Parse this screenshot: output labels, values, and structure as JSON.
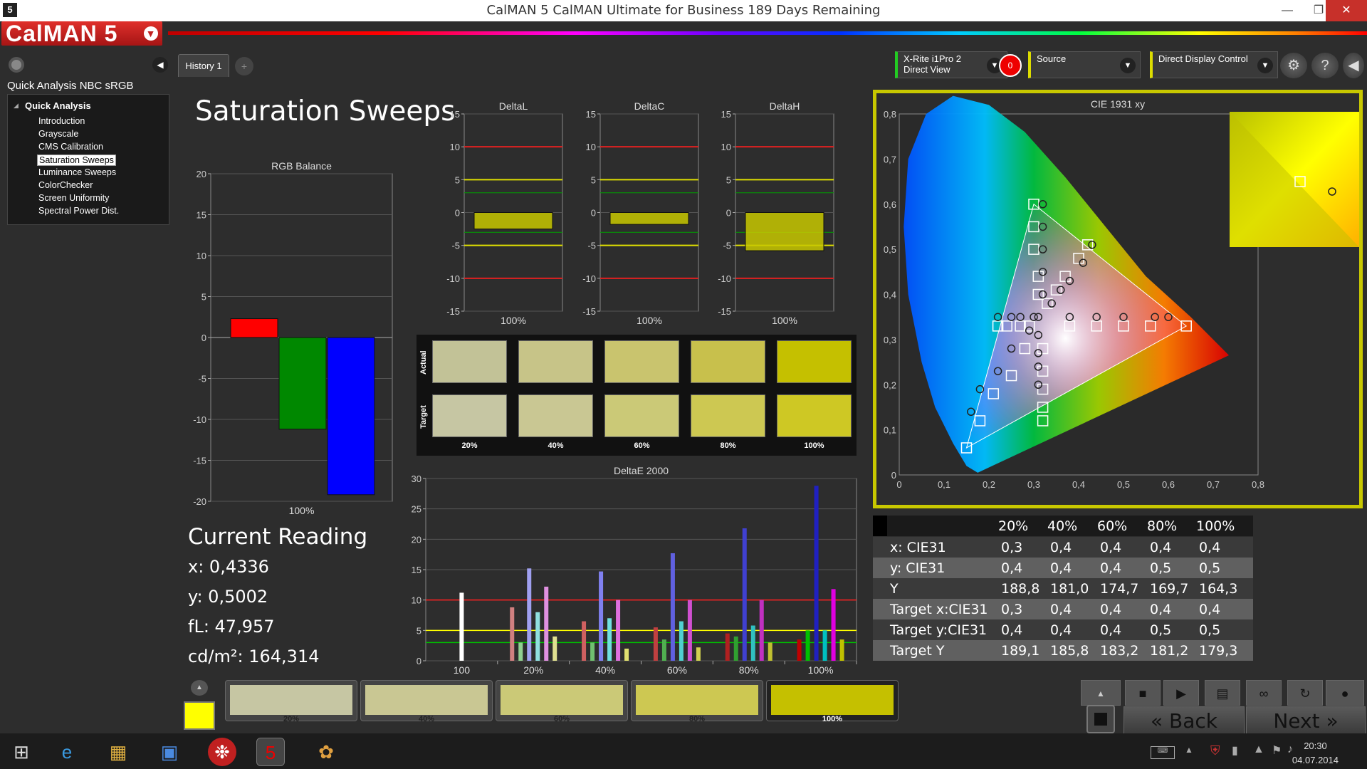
{
  "window": {
    "title": "CalMAN 5 CalMAN Ultimate for Business 189 Days Remaining",
    "app_icon": "5"
  },
  "app": {
    "logo": "CalMAN 5"
  },
  "sidebar": {
    "title": "Quick Analysis NBC sRGB",
    "tree_header": "Quick Analysis",
    "items": [
      {
        "label": "Introduction"
      },
      {
        "label": "Grayscale"
      },
      {
        "label": "CMS Calibration"
      },
      {
        "label": "Saturation Sweeps"
      },
      {
        "label": "Luminance Sweeps"
      },
      {
        "label": "ColorChecker"
      },
      {
        "label": "Screen Uniformity"
      },
      {
        "label": "Spectral Power Dist."
      }
    ]
  },
  "tabs": {
    "history": "History 1",
    "add": "+"
  },
  "page": {
    "title": "Saturation Sweeps"
  },
  "devices": {
    "meter_line1": "X-Rite i1Pro 2",
    "meter_line2": "Direct View",
    "record": "0",
    "source": "Source",
    "display": "Direct Display Control"
  },
  "current_reading": {
    "title": "Current Reading",
    "x": "x: 0,4336",
    "y": "y: 0,5002",
    "fl": "fL: 47,957",
    "cd": "cd/m²: 164,314"
  },
  "swatches": {
    "actual_label": "Actual",
    "target_label": "Target",
    "labels": [
      "20%",
      "40%",
      "60%",
      "80%",
      "100%"
    ],
    "actual_colors": [
      "#c2c297",
      "#c7c488",
      "#c9c46e",
      "#c8c04c",
      "#c5c000"
    ],
    "target_colors": [
      "#c6c6a3",
      "#c9c793",
      "#cbc977",
      "#cdc852",
      "#cec824"
    ]
  },
  "table": {
    "headers": [
      "20%",
      "40%",
      "60%",
      "80%",
      "100%"
    ],
    "rows": [
      {
        "label": "x: CIE31",
        "values": [
          "0,3",
          "0,4",
          "0,4",
          "0,4",
          "0,4"
        ]
      },
      {
        "label": "y: CIE31",
        "values": [
          "0,4",
          "0,4",
          "0,4",
          "0,5",
          "0,5"
        ]
      },
      {
        "label": "Y",
        "values": [
          "188,8",
          "181,0",
          "174,7",
          "169,7",
          "164,3"
        ]
      },
      {
        "label": "Target x:CIE31",
        "values": [
          "0,3",
          "0,4",
          "0,4",
          "0,4",
          "0,4"
        ]
      },
      {
        "label": "Target y:CIE31",
        "values": [
          "0,4",
          "0,4",
          "0,4",
          "0,5",
          "0,5"
        ]
      },
      {
        "label": "Target Y",
        "values": [
          "189,1",
          "185,8",
          "183,2",
          "181,2",
          "179,3"
        ]
      }
    ]
  },
  "bottom": {
    "swatch_labels": [
      "20%",
      "40%",
      "60%",
      "80%",
      "100%"
    ],
    "swatch_colors": [
      "#c6c6a3",
      "#c9c793",
      "#cbc977",
      "#cdc852",
      "#c5c000"
    ],
    "back": "Back",
    "next": "Next"
  },
  "taskbar": {
    "time": "20:30",
    "date": "04.07.2014"
  },
  "chart_data": [
    {
      "type": "bar",
      "title": "RGB Balance",
      "categories": [
        "100%"
      ],
      "ylim": [
        -20,
        20
      ],
      "yticks": [
        20,
        15,
        10,
        5,
        0,
        -5,
        -10,
        -15,
        -20
      ],
      "series": [
        {
          "color": "#ff0000",
          "values": [
            2.3
          ]
        },
        {
          "color": "#008800",
          "values": [
            -11.2
          ]
        },
        {
          "color": "#0000ff",
          "values": [
            -19.2
          ]
        }
      ]
    },
    {
      "type": "bar",
      "title": "DeltaL",
      "categories": [
        "100%"
      ],
      "ylim": [
        -15,
        15
      ],
      "yticks": [
        15,
        10,
        5,
        0,
        -5,
        -10,
        -15
      ],
      "values": [
        -2.5
      ]
    },
    {
      "type": "bar",
      "title": "DeltaC",
      "categories": [
        "100%"
      ],
      "ylim": [
        -15,
        15
      ],
      "yticks": [
        15,
        10,
        5,
        0,
        -5,
        -10,
        -15
      ],
      "values": [
        -1.8
      ]
    },
    {
      "type": "bar",
      "title": "DeltaH",
      "categories": [
        "100%"
      ],
      "ylim": [
        -15,
        15
      ],
      "yticks": [
        15,
        10,
        5,
        0,
        -5,
        -10,
        -15
      ],
      "values": [
        -5.8
      ]
    },
    {
      "type": "bar",
      "title": "DeltaE 2000",
      "categories": [
        "100",
        "20%",
        "40%",
        "60%",
        "80%",
        "100%"
      ],
      "ylim": [
        0,
        30
      ],
      "yticks": [
        30,
        25,
        20,
        15,
        10,
        5,
        0
      ],
      "groups": [
        {
          "category": "100",
          "bars": [
            {
              "color": "#ffffff",
              "value": 11.2
            }
          ]
        },
        {
          "category": "20%",
          "bars": [
            {
              "color": "#d08080",
              "value": 8.8
            },
            {
              "color": "#90d090",
              "value": 3
            },
            {
              "color": "#a0a0f0",
              "value": 15.2
            },
            {
              "color": "#90e0e0",
              "value": 8
            },
            {
              "color": "#e090e0",
              "value": 12.2
            },
            {
              "color": "#e0e090",
              "value": 4
            }
          ]
        },
        {
          "category": "40%",
          "bars": [
            {
              "color": "#d06060",
              "value": 6.5
            },
            {
              "color": "#70c070",
              "value": 3
            },
            {
              "color": "#8080f0",
              "value": 14.7
            },
            {
              "color": "#70e0e0",
              "value": 7
            },
            {
              "color": "#e070e0",
              "value": 10
            },
            {
              "color": "#e0e070",
              "value": 2
            }
          ]
        },
        {
          "category": "60%",
          "bars": [
            {
              "color": "#c04040",
              "value": 5.5
            },
            {
              "color": "#50b050",
              "value": 3.5
            },
            {
              "color": "#6060e0",
              "value": 17.7
            },
            {
              "color": "#50d0d0",
              "value": 6.5
            },
            {
              "color": "#d050d0",
              "value": 10
            },
            {
              "color": "#d0d050",
              "value": 2.2
            }
          ]
        },
        {
          "category": "80%",
          "bars": [
            {
              "color": "#b02020",
              "value": 4.5
            },
            {
              "color": "#30a030",
              "value": 4
            },
            {
              "color": "#4040d0",
              "value": 21.8
            },
            {
              "color": "#30c0c0",
              "value": 5.8
            },
            {
              "color": "#c030c0",
              "value": 10
            },
            {
              "color": "#c0c030",
              "value": 3
            }
          ]
        },
        {
          "category": "100%",
          "bars": [
            {
              "color": "#c00000",
              "value": 3.5
            },
            {
              "color": "#00c000",
              "value": 5
            },
            {
              "color": "#2020c0",
              "value": 28.8
            },
            {
              "color": "#00c0c0",
              "value": 5
            },
            {
              "color": "#e000e0",
              "value": 11.8
            },
            {
              "color": "#c0c000",
              "value": 3.5
            }
          ]
        }
      ],
      "reference_lines": [
        {
          "value": 10,
          "color": "#ff2020"
        },
        {
          "value": 5,
          "color": "#ffff00"
        },
        {
          "value": 3,
          "color": "#00c000"
        }
      ]
    },
    {
      "type": "scatter",
      "title": "CIE 1931 xy",
      "xlim": [
        0,
        0.8
      ],
      "ylim": [
        0,
        0.8
      ],
      "xticks": [
        "0",
        "0,1",
        "0,2",
        "0,3",
        "0,4",
        "0,5",
        "0,6",
        "0,7",
        "0,8"
      ],
      "yticks": [
        "0,8",
        "0,7",
        "0,6",
        "0,5",
        "0,4",
        "0,3",
        "0,2",
        "0,1",
        "0"
      ],
      "gamut": [
        [
          0.64,
          0.33
        ],
        [
          0.3,
          0.6
        ],
        [
          0.15,
          0.06
        ]
      ],
      "targets": [
        [
          0.3,
          0.6
        ],
        [
          0.3,
          0.55
        ],
        [
          0.3,
          0.5
        ],
        [
          0.31,
          0.44
        ],
        [
          0.31,
          0.4
        ],
        [
          0.22,
          0.33
        ],
        [
          0.24,
          0.33
        ],
        [
          0.27,
          0.33
        ],
        [
          0.29,
          0.33
        ],
        [
          0.38,
          0.33
        ],
        [
          0.44,
          0.33
        ],
        [
          0.5,
          0.33
        ],
        [
          0.56,
          0.33
        ],
        [
          0.64,
          0.33
        ],
        [
          0.15,
          0.06
        ],
        [
          0.18,
          0.12
        ],
        [
          0.21,
          0.18
        ],
        [
          0.25,
          0.22
        ],
        [
          0.28,
          0.28
        ],
        [
          0.32,
          0.12
        ],
        [
          0.32,
          0.15
        ],
        [
          0.32,
          0.19
        ],
        [
          0.32,
          0.23
        ],
        [
          0.32,
          0.28
        ],
        [
          0.42,
          0.51
        ],
        [
          0.4,
          0.48
        ],
        [
          0.37,
          0.44
        ],
        [
          0.35,
          0.41
        ],
        [
          0.33,
          0.38
        ]
      ],
      "measured": [
        [
          0.32,
          0.6
        ],
        [
          0.32,
          0.55
        ],
        [
          0.32,
          0.5
        ],
        [
          0.32,
          0.45
        ],
        [
          0.32,
          0.4
        ],
        [
          0.22,
          0.35
        ],
        [
          0.25,
          0.35
        ],
        [
          0.27,
          0.35
        ],
        [
          0.3,
          0.35
        ],
        [
          0.38,
          0.35
        ],
        [
          0.44,
          0.35
        ],
        [
          0.5,
          0.35
        ],
        [
          0.57,
          0.35
        ],
        [
          0.6,
          0.35
        ],
        [
          0.16,
          0.14
        ],
        [
          0.18,
          0.19
        ],
        [
          0.22,
          0.23
        ],
        [
          0.25,
          0.28
        ],
        [
          0.29,
          0.32
        ],
        [
          0.31,
          0.2
        ],
        [
          0.31,
          0.24
        ],
        [
          0.31,
          0.27
        ],
        [
          0.31,
          0.31
        ],
        [
          0.43,
          0.51
        ],
        [
          0.41,
          0.47
        ],
        [
          0.38,
          0.43
        ],
        [
          0.36,
          0.41
        ],
        [
          0.34,
          0.38
        ],
        [
          0.31,
          0.35
        ]
      ]
    }
  ]
}
